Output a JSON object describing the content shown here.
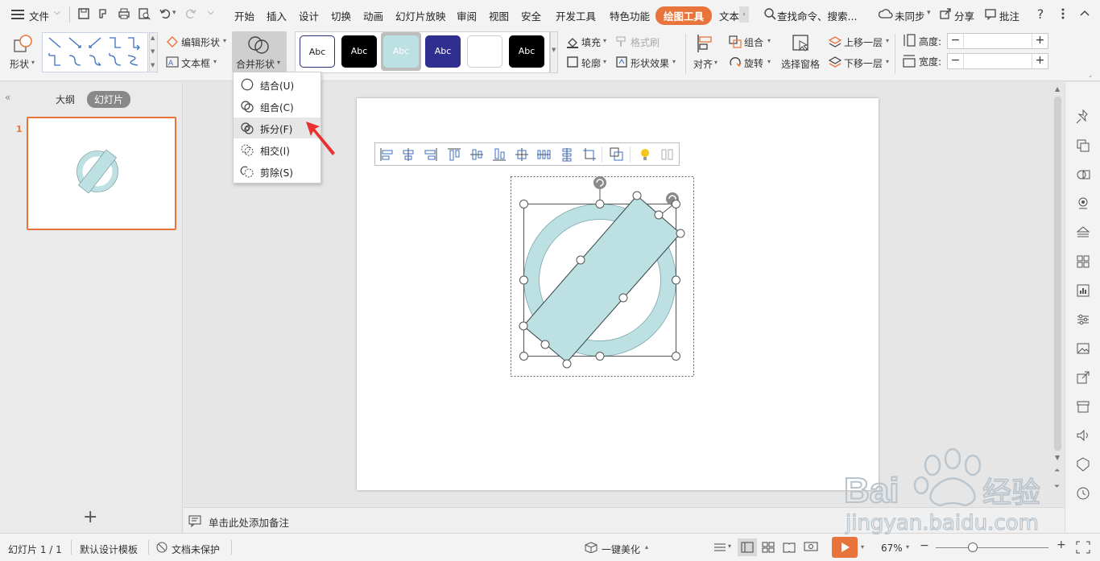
{
  "menubar": {
    "file_label": "文件",
    "tabs": [
      "开始",
      "插入",
      "设计",
      "切换",
      "动画",
      "幻灯片放映",
      "审阅",
      "视图",
      "安全",
      "开发工具",
      "特色功能",
      "绘图工具",
      "文本"
    ],
    "active_tab": "绘图工具",
    "search_label": "查找命令、搜索...",
    "sync_label": "未同步",
    "share_label": "分享",
    "comment_label": "批注"
  },
  "ribbon": {
    "shape_label": "形状",
    "edit_shape_label": "编辑形状",
    "textbox_label": "文本框",
    "merge_shape_label": "合并形状",
    "style_boxes": [
      "Abc",
      "Abc",
      "Abc",
      "Abc",
      "",
      "Abc"
    ],
    "fill_label": "填充",
    "format_brush_label": "格式刷",
    "outline_label": "轮廓",
    "shape_effect_label": "形状效果",
    "align_label": "对齐",
    "group_label": "组合",
    "rotate_label": "旋转",
    "select_pane_label": "选择窗格",
    "bring_forward_label": "上移一层",
    "send_backward_label": "下移一层",
    "height_label": "高度:",
    "width_label": "宽度:",
    "height_value": "",
    "width_value": ""
  },
  "dropdown": {
    "items": [
      "结合(U)",
      "组合(C)",
      "拆分(F)",
      "相交(I)",
      "剪除(S)"
    ],
    "highlighted": "拆分(F)"
  },
  "leftpanel": {
    "tab_outline": "大纲",
    "tab_slides": "幻灯片",
    "slide_number": "1"
  },
  "notes": {
    "placeholder": "单击此处添加备注"
  },
  "statusbar": {
    "slide_info": "幻灯片 1 / 1",
    "template": "默认设计模板",
    "protect": "文档未保护",
    "beautify": "一键美化",
    "zoom": "67%"
  },
  "colors": {
    "accent": "#e8743b",
    "shape_fill": "#bde0e3",
    "shape_stroke": "#4a5a5c",
    "arrow": "#e8312f"
  },
  "watermark": {
    "brand": "Bai",
    "brand_cn": "经验",
    "url": "jingyan.baidu.com"
  }
}
